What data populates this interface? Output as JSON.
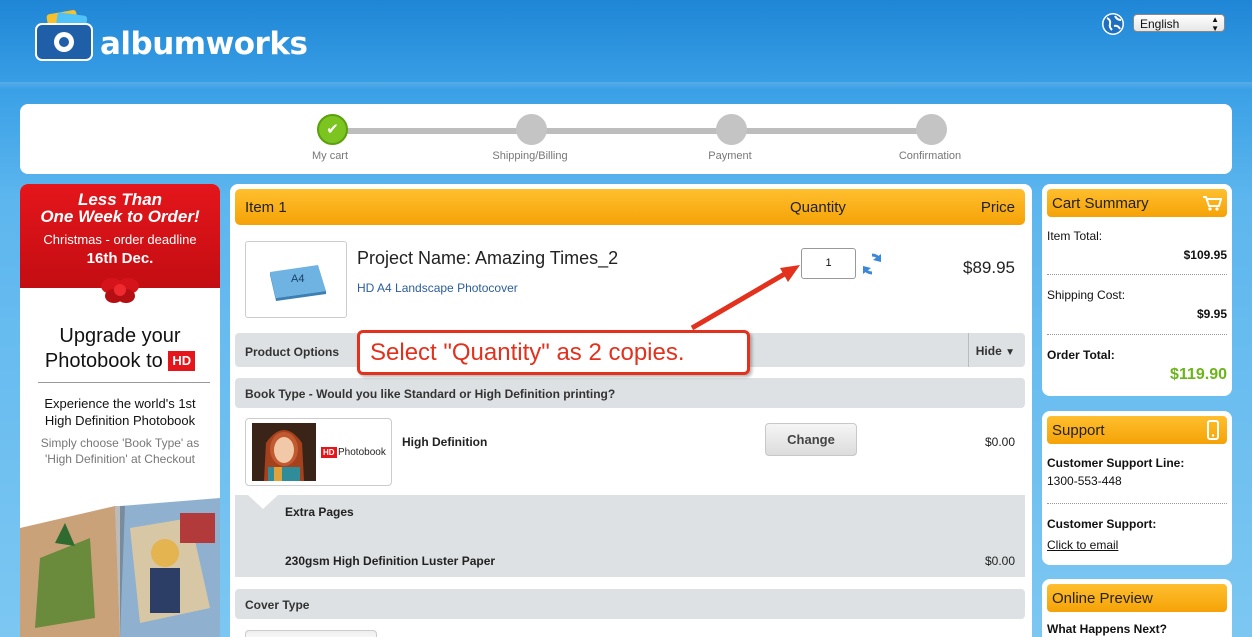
{
  "header": {
    "logo_text": "albumworks",
    "language": "English"
  },
  "progress": {
    "steps": [
      {
        "label": "My cart",
        "state": "done"
      },
      {
        "label": "Shipping/Billing",
        "state": "pending"
      },
      {
        "label": "Payment",
        "state": "pending"
      },
      {
        "label": "Confirmation",
        "state": "pending"
      }
    ]
  },
  "banner": {
    "line1": "Less Than",
    "line2": "One Week to Order!",
    "line3": "Christmas - order deadline",
    "line4": "16th Dec.",
    "upgrade_line1": "Upgrade your",
    "upgrade_line2": "Photobook to",
    "hd_badge": "HD",
    "experience_line1": "Experience the world's 1st",
    "experience_line2": "High Definition Photobook",
    "simply_line1": "Simply choose 'Book Type' as",
    "simply_line2": "'High Definition' at Checkout"
  },
  "cart": {
    "item_label": "Item 1",
    "quantity_header": "Quantity",
    "price_header": "Price",
    "thumb_label": "A4",
    "project_name": "Project Name: Amazing Times_2",
    "project_sub": "HD A4 Landscape Photocover",
    "quantity": "1",
    "price": "$89.95",
    "product_options_label": "Product Options",
    "hide_label": "Hide",
    "book_type_question": "Book Type - Would you like Standard or High Definition printing?",
    "hd_thumb_label": "Photobook",
    "hd_thumb_badge": "HD",
    "book_type_value": "High Definition",
    "change_label": "Change",
    "book_type_price": "$0.00",
    "extra_pages_label": "Extra Pages",
    "paper_label": "230gsm High Definition Luster Paper",
    "paper_price": "$0.00",
    "cover_type_label": "Cover Type"
  },
  "callout": {
    "text": "Select \"Quantity\" as 2 copies."
  },
  "summary": {
    "title": "Cart Summary",
    "item_total_label": "Item Total:",
    "item_total": "$109.95",
    "shipping_label": "Shipping Cost:",
    "shipping": "$9.95",
    "order_total_label": "Order Total:",
    "order_total": "$119.90"
  },
  "support": {
    "title": "Support",
    "line_label": "Customer Support Line:",
    "phone": "1300-553-448",
    "cs_label": "Customer Support:",
    "email_link": "Click to email"
  },
  "preview": {
    "title": "Online Preview",
    "question": "What Happens Next?"
  },
  "colors": {
    "accent_orange": "#f5a207",
    "success_green": "#7cc41f",
    "total_green": "#6cb519",
    "callout_red": "#e2311d",
    "banner_red": "#e4161b"
  }
}
